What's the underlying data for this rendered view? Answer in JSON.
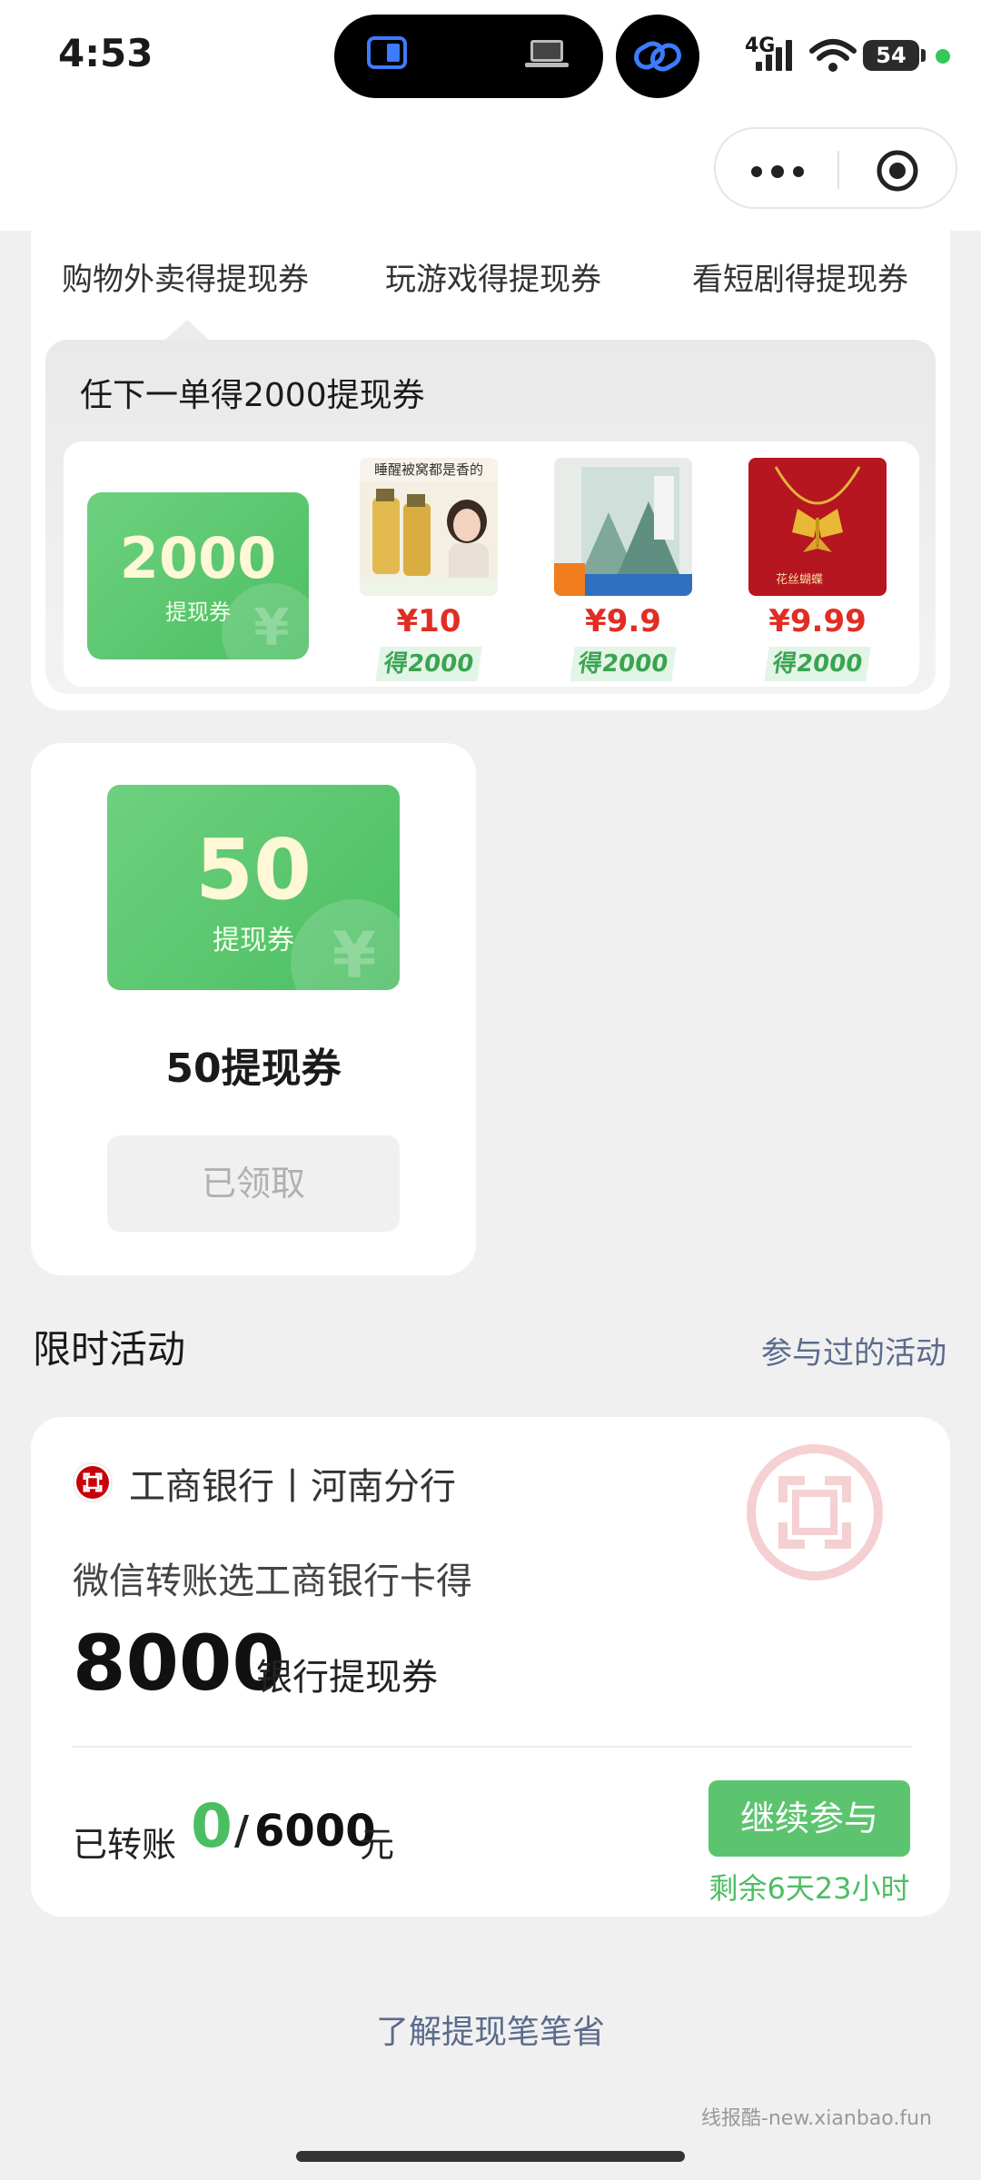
{
  "status_bar": {
    "time": "4:53",
    "network": "4G",
    "battery": "54",
    "icons": [
      "screen-mirror-icon",
      "laptop-icon",
      "link-icon",
      "signal-icon",
      "wifi-icon",
      "battery-icon"
    ]
  },
  "capsule": {
    "icons": [
      "more-dots-icon",
      "close-target-icon"
    ]
  },
  "tabs": [
    {
      "label": "购物外卖得提现券",
      "active": true
    },
    {
      "label": "玩游戏得提现券",
      "active": false
    },
    {
      "label": "看短剧得提现券",
      "active": false
    }
  ],
  "order_panel": {
    "title": "任下一单得2000提现券",
    "coupon": {
      "amount": "2000",
      "label": "提现券"
    },
    "products": [
      {
        "price": "¥10",
        "earn": "得2000",
        "image": "shampoo-product"
      },
      {
        "price": "¥9.9",
        "earn": "得2000",
        "image": "book-product"
      },
      {
        "price": "¥9.99",
        "earn": "得2000",
        "image": "butterfly-necklace-product"
      }
    ]
  },
  "coupon_card": {
    "amount": "50",
    "label": "提现券",
    "title": "50提现券",
    "button": "已领取"
  },
  "section": {
    "title": "限时活动",
    "link": "参与过的活动"
  },
  "bank_activity": {
    "bank_name": "工商银行丨河南分行",
    "promo_text": "微信转账选工商银行卡得",
    "amount": "8000",
    "unit": "银行提现券",
    "transfer_label": "已转账",
    "transfer_current": "0",
    "transfer_sep": "/",
    "transfer_total": "6000",
    "transfer_unit": "元",
    "button": "继续参与",
    "remaining": "剩余6天23小时"
  },
  "footer": {
    "learn_link": "了解提现笔笔省",
    "watermark": "线报酷-new.xianbao.fun"
  },
  "colors": {
    "accent_green": "#4cbe62",
    "price_red": "#e02e24",
    "link_gray_blue": "#5b6b8c",
    "background": "#f0f0f0"
  }
}
